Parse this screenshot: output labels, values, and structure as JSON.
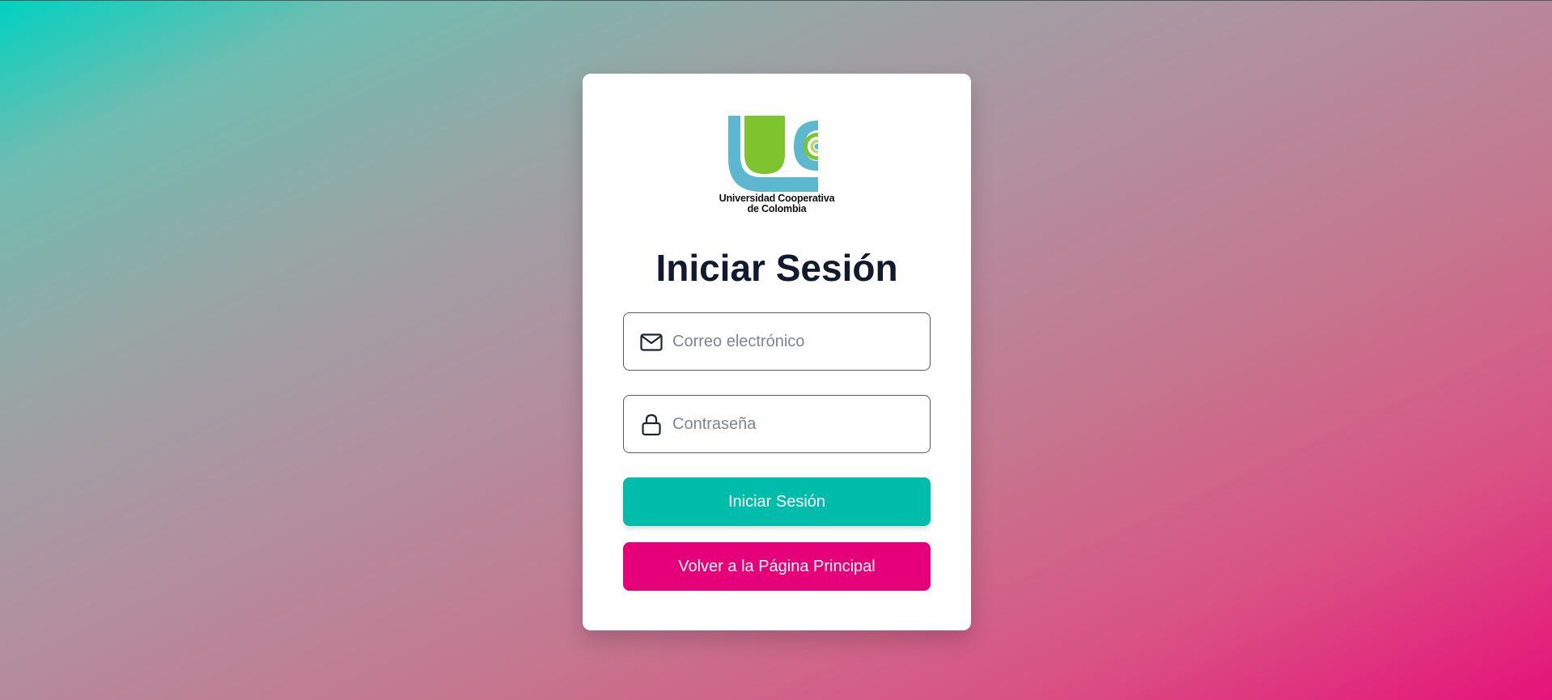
{
  "logo": {
    "line1": "Universidad Cooperativa",
    "line2": "de Colombia",
    "colors": {
      "blue": "#5bb8cf",
      "green": "#7dc42e"
    }
  },
  "login_form": {
    "title": "Iniciar Sesión",
    "email": {
      "placeholder": "Correo electrónico",
      "value": "",
      "icon": "mail-icon"
    },
    "password": {
      "placeholder": "Contraseña",
      "value": "",
      "icon": "lock-icon"
    },
    "submit_label": "Iniciar Sesión",
    "back_label": "Volver a la Página Principal"
  },
  "colors": {
    "primary_button": "#00bcaa",
    "secondary_button": "#e5007a",
    "title_text": "#111a2e",
    "background_start": "#00d2c0",
    "background_end": "#e6137a"
  }
}
